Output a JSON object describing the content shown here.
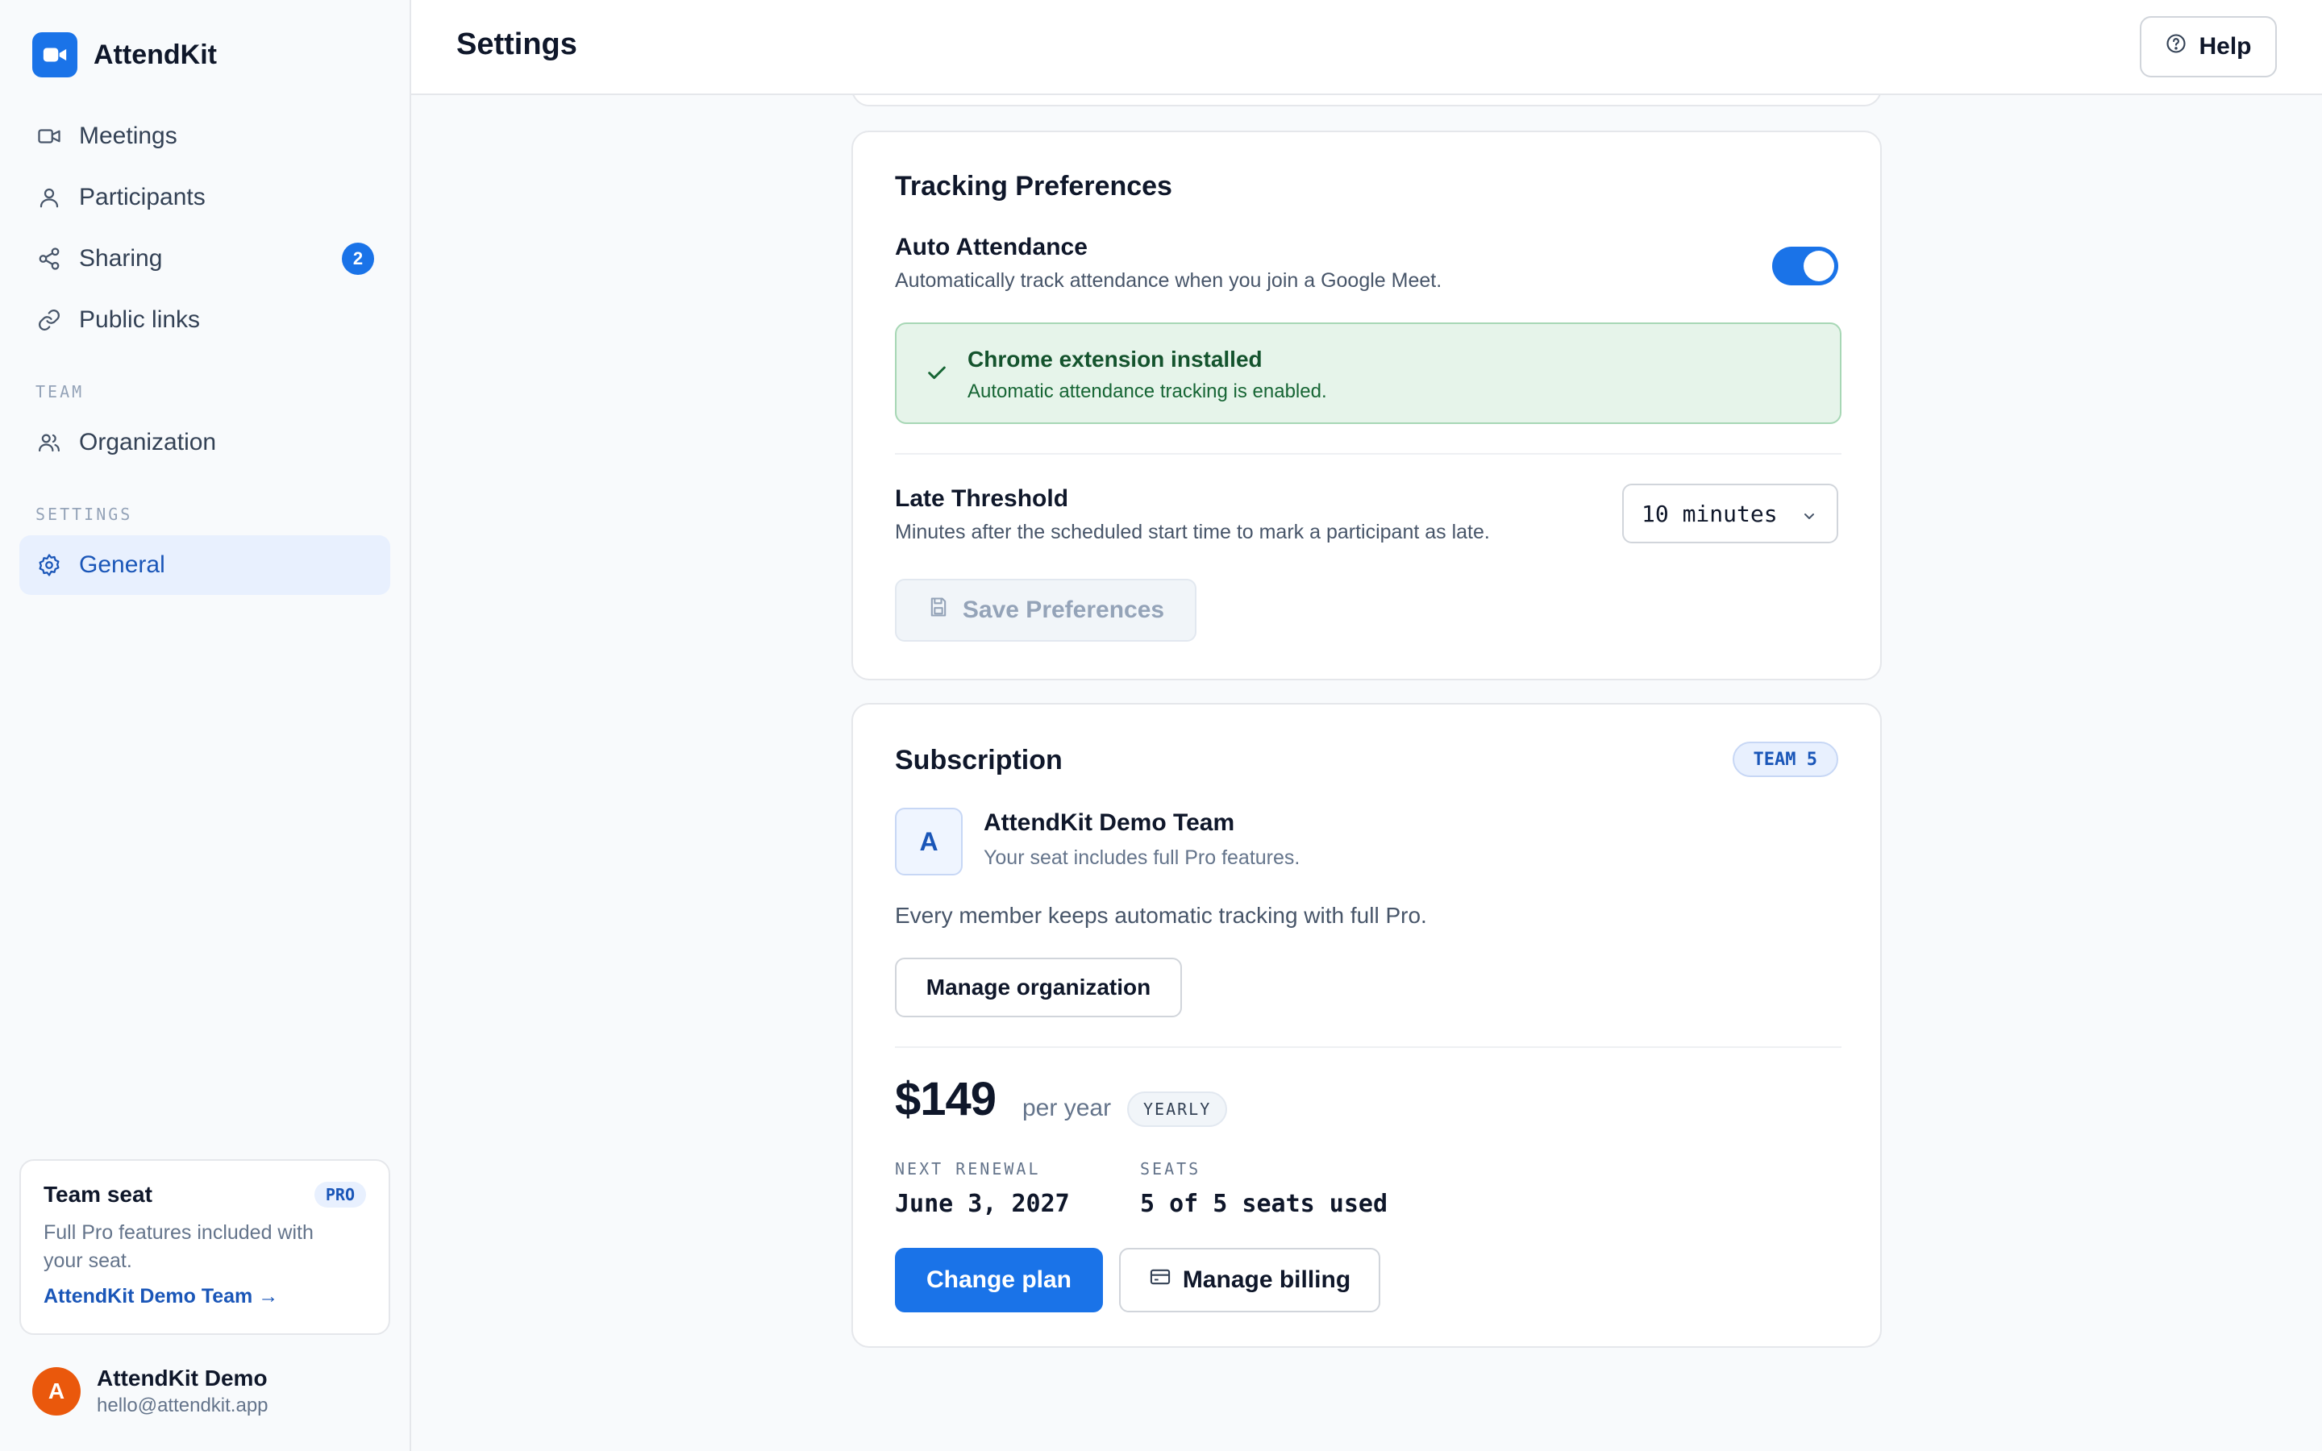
{
  "app": {
    "name": "AttendKit"
  },
  "sidebar": {
    "items": [
      {
        "label": "Meetings",
        "icon": "video-icon"
      },
      {
        "label": "Participants",
        "icon": "user-icon"
      },
      {
        "label": "Sharing",
        "icon": "share-icon",
        "badge": "2"
      },
      {
        "label": "Public links",
        "icon": "link-icon"
      }
    ],
    "team_section": "TEAM",
    "team_items": [
      {
        "label": "Organization",
        "icon": "users-icon"
      }
    ],
    "settings_section": "SETTINGS",
    "settings_items": [
      {
        "label": "General",
        "icon": "gear-icon",
        "active": true
      }
    ],
    "seat_card": {
      "title": "Team seat",
      "badge": "PRO",
      "description": "Full Pro features included with your seat.",
      "link": "AttendKit Demo Team →"
    },
    "user": {
      "initial": "A",
      "name": "AttendKit Demo",
      "email": "hello@attendkit.app"
    }
  },
  "header": {
    "title": "Settings",
    "help_label": "Help"
  },
  "tracking": {
    "title": "Tracking Preferences",
    "auto_attendance": {
      "title": "Auto Attendance",
      "description": "Automatically track attendance when you join a Google Meet.",
      "enabled": true
    },
    "extension": {
      "title": "Chrome extension installed",
      "description": "Automatic attendance tracking is enabled."
    },
    "late_threshold": {
      "title": "Late Threshold",
      "description": "Minutes after the scheduled start time to mark a participant as late.",
      "value": "10 minutes"
    },
    "save_label": "Save Preferences"
  },
  "subscription": {
    "title": "Subscription",
    "plan_badge": "TEAM 5",
    "org": {
      "initial": "A",
      "name": "AttendKit Demo Team",
      "description": "Your seat includes full Pro features."
    },
    "note": "Every member keeps automatic tracking with full Pro.",
    "manage_org_label": "Manage organization",
    "price": "$149",
    "period": "per year",
    "billing_badge": "YEARLY",
    "renewal_label": "NEXT RENEWAL",
    "renewal_value": "June 3, 2027",
    "seats_label": "SEATS",
    "seats_value": "5 of 5 seats used",
    "change_plan_label": "Change plan",
    "manage_billing_label": "Manage billing"
  },
  "colors": {
    "accent": "#1a73e8",
    "success_bg": "#e6f4ea",
    "avatar": "#ea580c"
  }
}
